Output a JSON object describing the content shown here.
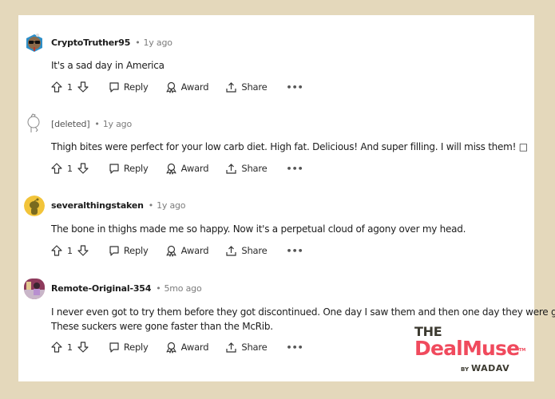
{
  "comments": [
    {
      "username": "CryptoTruther95",
      "separator": "•",
      "time": "1y ago",
      "text_lines": [
        "It's a sad day in America"
      ],
      "votes": "1",
      "avatar": "sunglasses-snoo-avatar"
    },
    {
      "username": "[deleted]",
      "separator": "•",
      "time": "1y ago",
      "text_lines": [
        "Thigh bites were perfect for your low carb diet. High fat. Delicious! And super filling. I will miss them! □"
      ],
      "votes": "1",
      "avatar": "deleted-snoo-avatar"
    },
    {
      "username": "severalthingstaken",
      "separator": "•",
      "time": "1y ago",
      "text_lines": [
        "The bone in thighs made me so happy. Now it's a perpetual cloud of agony over my head."
      ],
      "votes": "1",
      "avatar": "yellow-snoo-avatar"
    },
    {
      "username": "Remote-Original-354",
      "separator": "•",
      "time": "5mo ago",
      "text_lines": [
        "I never even got to try them before they got discontinued. One day I saw them and then one day they were gone.",
        "These suckers were gone faster than the McRib."
      ],
      "votes": "1",
      "avatar": "cartoon-photo-avatar"
    }
  ],
  "actions": {
    "reply": "Reply",
    "award": "Award",
    "share": "Share",
    "more": "•••"
  },
  "logo": {
    "the": "THE",
    "name": "DealMuse",
    "tm": "TM",
    "by": "BY",
    "brand": "WADAV",
    "colors": {
      "primary": "#f04a5d",
      "dark": "#3c3a30"
    }
  },
  "colors": {
    "background": "#e4d8bb",
    "card": "#ffffff"
  }
}
